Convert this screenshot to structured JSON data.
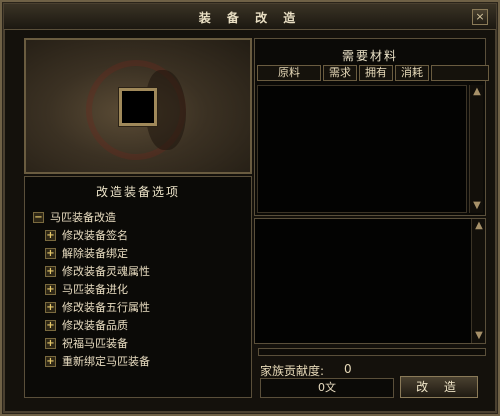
{
  "window": {
    "title": "装 备 改 造",
    "close_label": "×"
  },
  "options": {
    "title": "改造装备选项",
    "root": {
      "toggle": "−",
      "label": "马匹装备改造"
    },
    "items": [
      {
        "toggle": "+",
        "label": "修改装备签名"
      },
      {
        "toggle": "+",
        "label": "解除装备绑定"
      },
      {
        "toggle": "+",
        "label": "修改装备灵魂属性"
      },
      {
        "toggle": "+",
        "label": "马匹装备进化"
      },
      {
        "toggle": "+",
        "label": "修改装备五行属性"
      },
      {
        "toggle": "+",
        "label": "修改装备品质"
      },
      {
        "toggle": "+",
        "label": "祝福马匹装备"
      },
      {
        "toggle": "+",
        "label": "重新绑定马匹装备"
      }
    ]
  },
  "materials": {
    "title": "需要材料",
    "columns": [
      "原料",
      "需求",
      "拥有",
      "消耗"
    ],
    "scroll_up": "▲",
    "scroll_down": "▼"
  },
  "footer": {
    "progress": 0,
    "contribution_label": "家族贡献度:",
    "contribution_value": "0",
    "money": "0文",
    "action_label": "改 造"
  }
}
